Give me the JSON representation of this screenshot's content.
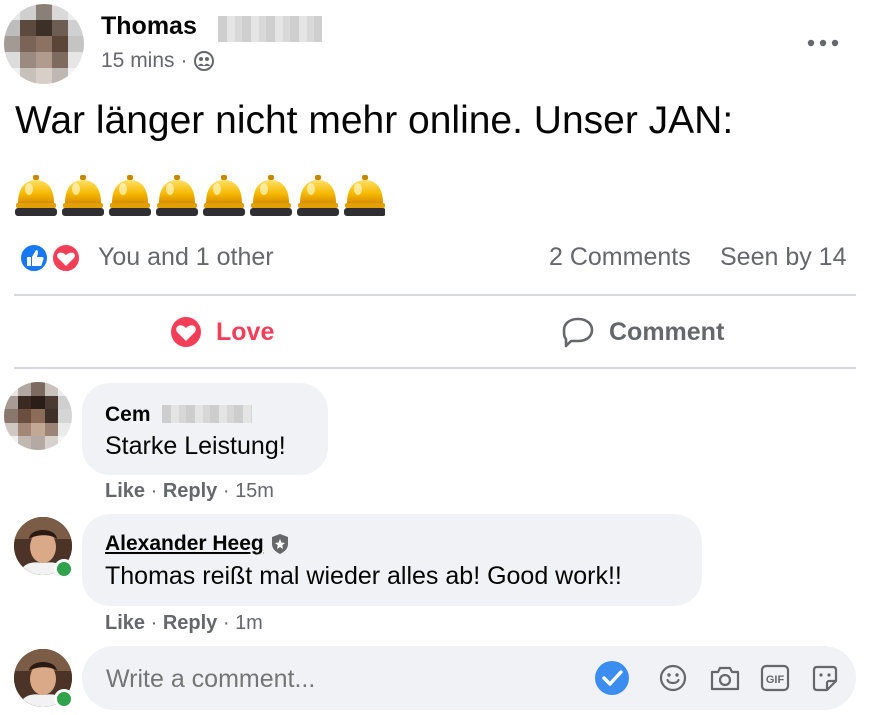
{
  "post": {
    "author_first": "Thomas",
    "time": "15 mins",
    "separator": "·",
    "audience_icon": "friends-icon",
    "more_icon": "ellipsis-icon",
    "text": "War länger nicht mehr online. Unser JAN:",
    "emoji_row": [
      "🛎",
      "🛎",
      "🛎",
      "🛎",
      "🛎",
      "🛎",
      "🛎",
      "🛎"
    ]
  },
  "reactions": {
    "summary": "You and 1 other",
    "comments_count": "2 Comments",
    "seen_by": "Seen by 14"
  },
  "actions": {
    "love_label": "Love",
    "comment_label": "Comment"
  },
  "comments": [
    {
      "name": "Cem",
      "text": "Starke Leistung!",
      "like": "Like",
      "reply": "Reply",
      "time": "15m"
    },
    {
      "name": "Alexander Heeg",
      "text": "Thomas reißt mal wieder alles ab! Good work!!",
      "like": "Like",
      "reply": "Reply",
      "time": "1m"
    }
  ],
  "composer": {
    "placeholder": "Write a comment...",
    "gif_label": "GIF"
  },
  "colors": {
    "love": "#f33e58",
    "like_blue": "#1877f2",
    "online": "#31a24c",
    "bubble": "#f0f2f5"
  }
}
